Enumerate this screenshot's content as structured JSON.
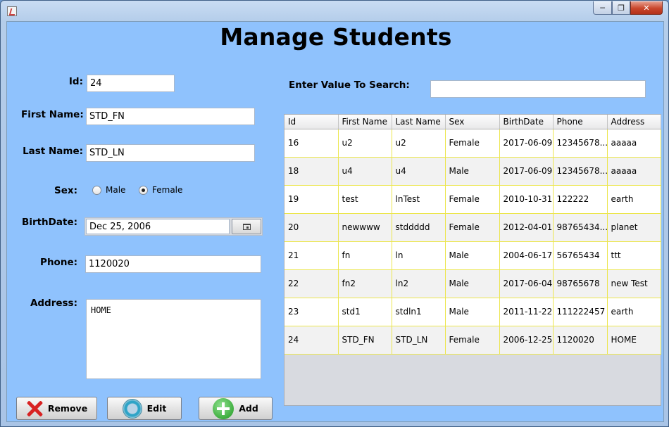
{
  "window": {
    "title": "",
    "icon": "java-cup-icon"
  },
  "page": {
    "title": "Manage Students"
  },
  "form": {
    "id_label": "Id:",
    "id_value": "24",
    "first_name_label": "First Name:",
    "first_name_value": "STD_FN",
    "last_name_label": "Last Name:",
    "last_name_value": "STD_LN",
    "sex_label": "Sex:",
    "sex_options": [
      "Male",
      "Female"
    ],
    "sex_selected": "Female",
    "birthdate_label": "BirthDate:",
    "birthdate_value": "Dec 25, 2006",
    "phone_label": "Phone:",
    "phone_value": "1120020",
    "address_label": "Address:",
    "address_value": "HOME"
  },
  "search": {
    "label": "Enter Value To Search:",
    "value": ""
  },
  "buttons": {
    "remove": "Remove",
    "edit": "Edit",
    "add": "Add"
  },
  "table": {
    "columns": [
      "Id",
      "First Name",
      "Last Name",
      "Sex",
      "BirthDate",
      "Phone",
      "Address"
    ],
    "rows": [
      [
        "16",
        "u2",
        "u2",
        "Female",
        "2017-06-09",
        "12345678...",
        "aaaaa"
      ],
      [
        "18",
        "u4",
        "u4",
        "Male",
        "2017-06-09",
        "12345678...",
        "aaaaa"
      ],
      [
        "19",
        "test",
        "lnTest",
        "Female",
        "2010-10-31",
        "122222",
        "earth"
      ],
      [
        "20",
        "newwww",
        "stddddd",
        "Female",
        "2012-04-01",
        "98765434...",
        "planet"
      ],
      [
        "21",
        "fn",
        "ln",
        "Male",
        "2004-06-17",
        "56765434",
        "ttt"
      ],
      [
        "22",
        "fn2",
        "ln2",
        "Male",
        "2017-06-04",
        "98765678",
        "new Test"
      ],
      [
        "23",
        "std1",
        "stdln1",
        "Male",
        "2011-11-22",
        "111222457",
        "earth"
      ],
      [
        "24",
        "STD_FN",
        "STD_LN",
        "Female",
        "2006-12-25",
        "1120020",
        "HOME"
      ]
    ]
  },
  "colors": {
    "client_bg": "#8fc2fd",
    "grid_line": "#ece64d",
    "close_btn": "#c9462c"
  }
}
